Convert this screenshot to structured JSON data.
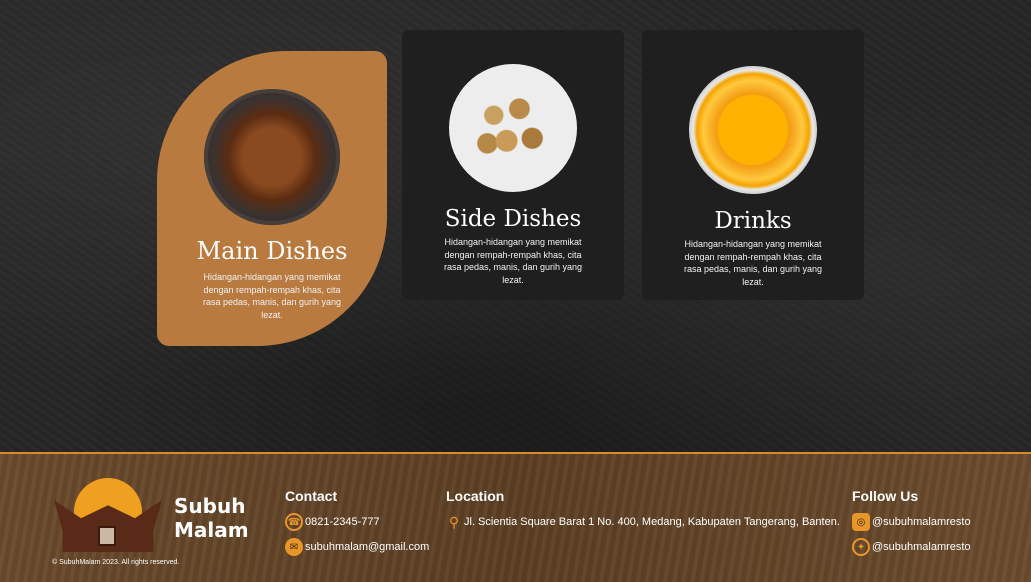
{
  "menu": {
    "cards": [
      {
        "title": "Main Dishes",
        "description": "Hidangan-hidangan yang memikat dengan rempah-rempah khas, cita rasa pedas, manis, dan gurih yang lezat."
      },
      {
        "title": "Side Dishes",
        "description": "Hidangan-hidangan yang memikat dengan rempah-rempah khas, cita rasa pedas, manis, dan gurih yang lezat."
      },
      {
        "title": "Drinks",
        "description": "Hidangan-hidangan yang memikat dengan rempah-rempah khas, cita rasa pedas, manis, dan gurih yang lezat."
      }
    ]
  },
  "footer": {
    "brand_line1": "Subuh",
    "brand_line2": "Malam",
    "copyright": "© SubuhMalam 2023. All rights reserved.",
    "contact": {
      "heading": "Contact",
      "phone": "0821-2345-777",
      "email": "subuhmalam@gmail.com"
    },
    "location": {
      "heading": "Location",
      "address": "Jl. Scientia Square Barat 1 No. 400, Medang, Kabupaten Tangerang, Banten."
    },
    "follow": {
      "heading": "Follow Us",
      "instagram": "@subuhmalamresto",
      "twitter": "@subuhmalamresto"
    }
  },
  "colors": {
    "accent": "#e8962a",
    "active_card": "#b97a3f",
    "footer_bg": "#5c3f24"
  },
  "icons": [
    "phone-icon",
    "mail-icon",
    "map-pin-icon",
    "instagram-icon",
    "twitter-icon"
  ]
}
